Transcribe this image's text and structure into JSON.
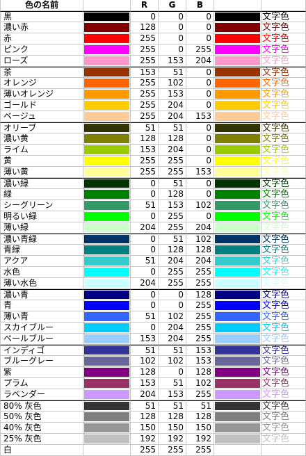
{
  "header": {
    "name": "色の名前",
    "r": "R",
    "g": "G",
    "b": "B"
  },
  "sample_label": "文字色",
  "colors": [
    {
      "name": "黒",
      "r": "0",
      "g": "0",
      "b": "0",
      "hex": "#000000",
      "group_start": true
    },
    {
      "name": "濃い赤",
      "r": "128",
      "g": "0",
      "b": "0",
      "hex": "#800000"
    },
    {
      "name": "赤",
      "r": "255",
      "g": "0",
      "b": "0",
      "hex": "#ff0000"
    },
    {
      "name": "ピンク",
      "r": "255",
      "g": "0",
      "b": "255",
      "hex": "#ff00ff"
    },
    {
      "name": "ローズ",
      "r": "255",
      "g": "153",
      "b": "204",
      "hex": "#ff99cc"
    },
    {
      "name": "茶",
      "r": "153",
      "g": "51",
      "b": "0",
      "hex": "#993300",
      "group_start": true
    },
    {
      "name": "オレンジ",
      "r": "255",
      "g": "102",
      "b": "0",
      "hex": "#ff6600"
    },
    {
      "name": "薄いオレンジ",
      "r": "255",
      "g": "153",
      "b": "0",
      "hex": "#ff9900"
    },
    {
      "name": "ゴールド",
      "r": "255",
      "g": "204",
      "b": "0",
      "hex": "#ffcc00"
    },
    {
      "name": "ベージュ",
      "r": "255",
      "g": "204",
      "b": "153",
      "hex": "#ffcc99"
    },
    {
      "name": "オリーブ",
      "r": "51",
      "g": "51",
      "b": "0",
      "hex": "#333300",
      "group_start": true
    },
    {
      "name": "濃い黄",
      "r": "128",
      "g": "128",
      "b": "0",
      "hex": "#808000"
    },
    {
      "name": "ライム",
      "r": "153",
      "g": "204",
      "b": "0",
      "hex": "#99cc00"
    },
    {
      "name": "黄",
      "r": "255",
      "g": "255",
      "b": "0",
      "hex": "#ffff00"
    },
    {
      "name": "薄い黄",
      "r": "255",
      "g": "255",
      "b": "153",
      "hex": "#ffff99"
    },
    {
      "name": "濃い緑",
      "r": "0",
      "g": "51",
      "b": "0",
      "hex": "#003300",
      "group_start": true
    },
    {
      "name": "緑",
      "r": "0",
      "g": "128",
      "b": "0",
      "hex": "#008000"
    },
    {
      "name": "シーグリーン",
      "r": "51",
      "g": "153",
      "b": "102",
      "hex": "#339966"
    },
    {
      "name": "明るい緑",
      "r": "0",
      "g": "255",
      "b": "0",
      "hex": "#00ff00"
    },
    {
      "name": "薄い緑",
      "r": "204",
      "g": "255",
      "b": "204",
      "hex": "#ccffcc"
    },
    {
      "name": "濃い青緑",
      "r": "0",
      "g": "51",
      "b": "102",
      "hex": "#003366",
      "group_start": true
    },
    {
      "name": "青緑",
      "r": "0",
      "g": "128",
      "b": "128",
      "hex": "#008080"
    },
    {
      "name": "アクア",
      "r": "51",
      "g": "204",
      "b": "204",
      "hex": "#33cccc"
    },
    {
      "name": "水色",
      "r": "0",
      "g": "255",
      "b": "255",
      "hex": "#00ffff"
    },
    {
      "name": "薄い水色",
      "r": "204",
      "g": "255",
      "b": "255",
      "hex": "#ccffff"
    },
    {
      "name": "濃い青",
      "r": "0",
      "g": "0",
      "b": "128",
      "hex": "#000080",
      "group_start": true
    },
    {
      "name": "青",
      "r": "0",
      "g": "0",
      "b": "255",
      "hex": "#0000ff"
    },
    {
      "name": "薄い青",
      "r": "51",
      "g": "102",
      "b": "255",
      "hex": "#3366ff"
    },
    {
      "name": "スカイブルー",
      "r": "0",
      "g": "204",
      "b": "255",
      "hex": "#00ccff"
    },
    {
      "name": "ペールブルー",
      "r": "153",
      "g": "204",
      "b": "255",
      "hex": "#99ccff"
    },
    {
      "name": "インディゴ",
      "r": "51",
      "g": "51",
      "b": "153",
      "hex": "#333399",
      "group_start": true
    },
    {
      "name": "ブルーグレー",
      "r": "102",
      "g": "102",
      "b": "153",
      "hex": "#666699"
    },
    {
      "name": "紫",
      "r": "128",
      "g": "0",
      "b": "128",
      "hex": "#800080"
    },
    {
      "name": "プラム",
      "r": "153",
      "g": "51",
      "b": "102",
      "hex": "#993366"
    },
    {
      "name": "ラベンダー",
      "r": "204",
      "g": "153",
      "b": "255",
      "hex": "#cc99ff"
    },
    {
      "name": "80% 灰色",
      "r": "51",
      "g": "51",
      "b": "51",
      "hex": "#333333",
      "group_start": true
    },
    {
      "name": "50% 灰色",
      "r": "128",
      "g": "128",
      "b": "128",
      "hex": "#808080"
    },
    {
      "name": "40% 灰色",
      "r": "150",
      "g": "150",
      "b": "150",
      "hex": "#969696"
    },
    {
      "name": "25% 灰色",
      "r": "192",
      "g": "192",
      "b": "192",
      "hex": "#c0c0c0"
    },
    {
      "name": "白",
      "r": "255",
      "g": "255",
      "b": "255",
      "hex": "#ffffff"
    }
  ]
}
